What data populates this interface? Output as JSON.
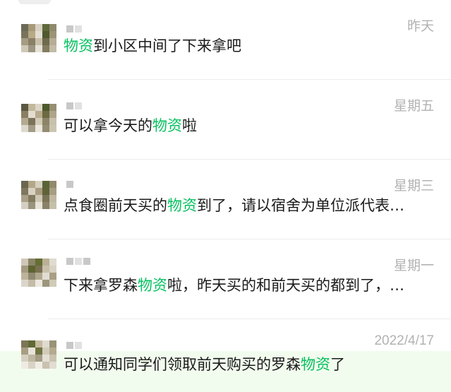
{
  "colors": {
    "accent": "#07c160",
    "time": "#b2b2b2",
    "highlight_bg": "#f2fcee"
  },
  "keyword": "物资",
  "results": [
    {
      "time": "昨天",
      "pre": "",
      "kw": "物资",
      "post": "到小区中间了下来拿吧"
    },
    {
      "time": "星期五",
      "pre": "可以拿今天的",
      "kw": "物资",
      "post": "啦"
    },
    {
      "time": "星期三",
      "pre": "点食圈前天买的",
      "kw": "物资",
      "post": "到了，请以宿舍为单位派代表…"
    },
    {
      "time": "星期一",
      "pre": "下来拿罗森",
      "kw": "物资",
      "post": "啦，昨天买的和前天买的都到了，…"
    },
    {
      "time": "2022/4/17",
      "pre": "可以通知同学们领取前天购买的罗森",
      "kw": "物资",
      "post": "了"
    }
  ]
}
